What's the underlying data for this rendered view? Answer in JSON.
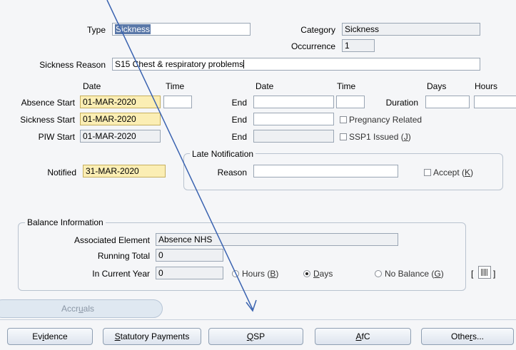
{
  "header": {
    "type_label": "Type",
    "type_value": "Sickness",
    "category_label": "Category",
    "category_value": "Sickness",
    "occurrence_label": "Occurrence",
    "occurrence_value": "1",
    "reason_label": "Sickness Reason",
    "reason_value_prefix": "S15 Chest & respiratory problems"
  },
  "columns": {
    "date1": "Date",
    "time1": "Time",
    "date2": "Date",
    "time2": "Time",
    "days": "Days",
    "hours": "Hours"
  },
  "rows": {
    "absence_start_label": "Absence Start",
    "absence_start_date": "01-MAR-2020",
    "sickness_start_label": "Sickness Start",
    "sickness_start_date": "01-MAR-2020",
    "piw_start_label": "PIW Start",
    "piw_start_date": "01-MAR-2020",
    "end_label": "End",
    "duration_label": "Duration",
    "pregnancy_label": "Pregnancy Related",
    "ssp1_label_prefix": "SSP1 Issued (",
    "ssp1_label_key": "J",
    "ssp1_label_suffix": ")"
  },
  "late_notification": {
    "title": "Late Notification",
    "reason_label": "Reason",
    "accept_prefix": "Accept (",
    "accept_key": "K",
    "accept_suffix": ")"
  },
  "notified": {
    "label": "Notified",
    "value": "31-MAR-2020"
  },
  "balance": {
    "title": "Balance Information",
    "assoc_label": "Associated Element",
    "assoc_value": "Absence NHS",
    "running_label": "Running Total",
    "running_value": "0",
    "current_label": "In Current Year",
    "current_value": "0",
    "hours_prefix": "Hours (",
    "hours_key": "B",
    "hours_suffix": ")",
    "days_key": "D",
    "days_rest": "ays",
    "nobal_prefix": "No Balance (",
    "nobal_key": "G",
    "nobal_suffix": ")",
    "bracket_open": "[",
    "bracket_close": "]",
    "selected_option": "Days"
  },
  "tab": {
    "label_pre": "Accr",
    "label_key": "u",
    "label_post": "als"
  },
  "buttons": {
    "evidence_pre": "Ev",
    "evidence_key": "i",
    "evidence_post": "dence",
    "statutory_key": "S",
    "statutory_post": "tatutory Payments",
    "qsp_key": "Q",
    "qsp_post": "SP",
    "afc_key": "A",
    "afc_post": "fC",
    "others_pre": "Othe",
    "others_key": "r",
    "others_post": "s..."
  },
  "colors": {
    "required_field": "#fbeeb4",
    "selection": "#5a78a8",
    "annotation_arrow": "#3a63b0"
  }
}
